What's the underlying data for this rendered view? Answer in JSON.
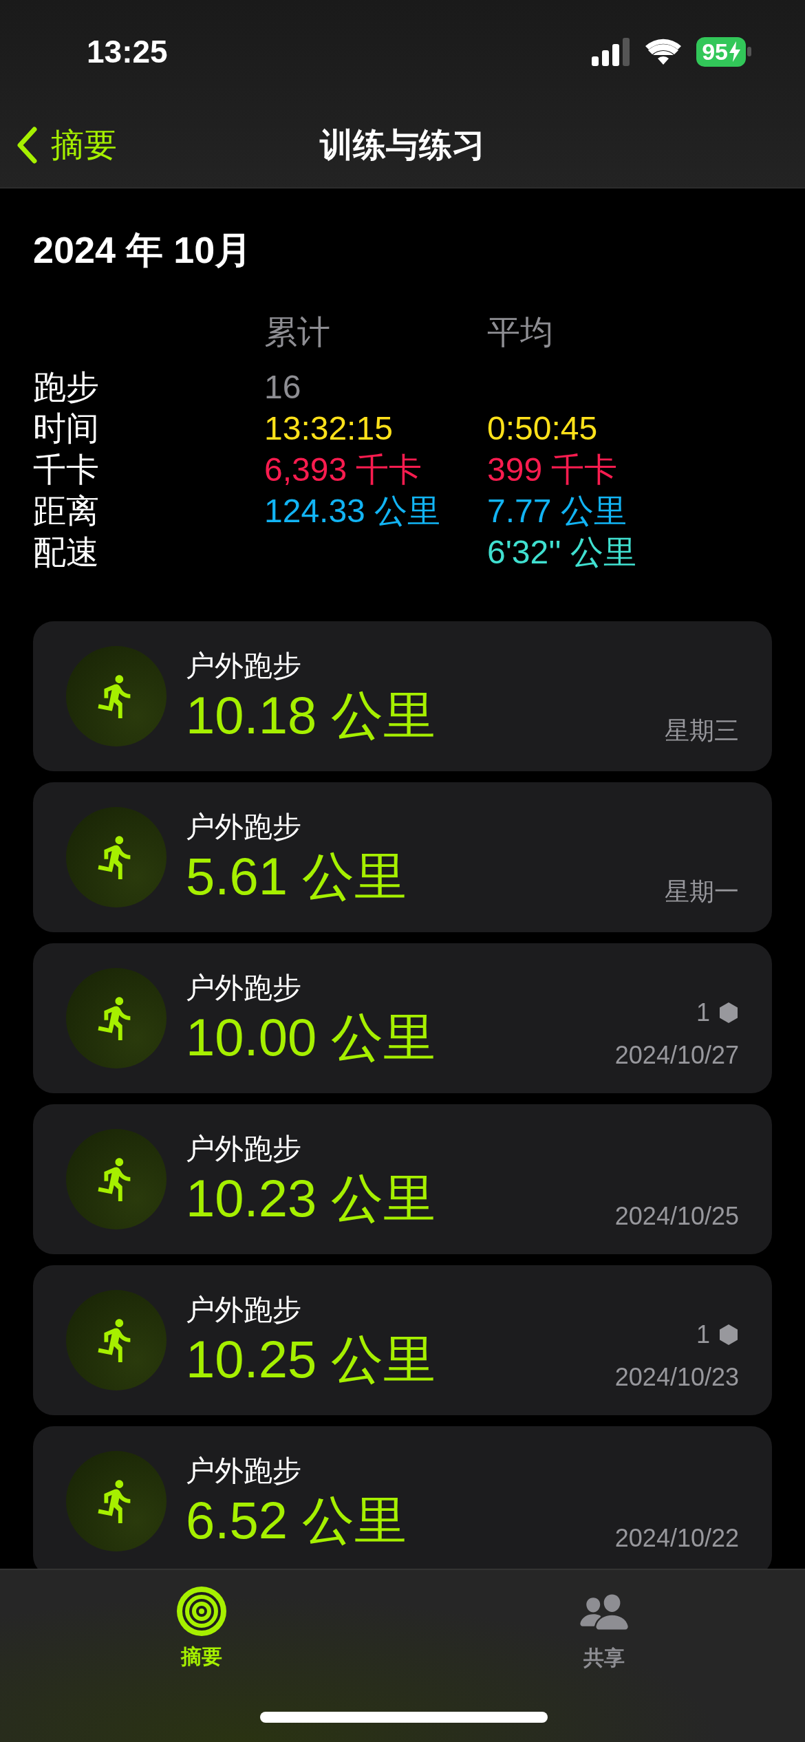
{
  "status_bar": {
    "time": "13:25",
    "battery": "95"
  },
  "nav": {
    "back": "摘要",
    "title": "训练与练习"
  },
  "month": "2024 年 10月",
  "stats": {
    "columns": [
      "累计",
      "平均"
    ],
    "rows": [
      {
        "label": "跑步",
        "total": "16",
        "color": "#8e8e93"
      },
      {
        "label": "时间",
        "total": "13:32:15",
        "average": "0:50:45",
        "color": "#ffe11a"
      },
      {
        "label": "千卡",
        "total": "6,393 千卡",
        "average": "399 千卡",
        "color": "#fa1c4f"
      },
      {
        "label": "距离",
        "total": "124.33 公里",
        "average": "7.77 公里",
        "color": "#12b4f4"
      },
      {
        "label": "配速",
        "average": "6'32'' 公里",
        "color": "#40e0d0"
      }
    ]
  },
  "workouts": [
    {
      "title": "户外跑步",
      "distance": "10.18 公里",
      "date": "星期三"
    },
    {
      "title": "户外跑步",
      "distance": "5.61 公里",
      "date": "星期一"
    },
    {
      "title": "户外跑步",
      "distance": "10.00 公里",
      "date": "2024/10/27",
      "badge": "1"
    },
    {
      "title": "户外跑步",
      "distance": "10.23 公里",
      "date": "2024/10/25"
    },
    {
      "title": "户外跑步",
      "distance": "10.25 公里",
      "date": "2024/10/23",
      "badge": "1"
    },
    {
      "title": "户外跑步",
      "distance": "6.52 公里",
      "date": "2024/10/22"
    }
  ],
  "tabs": [
    {
      "label": "摘要",
      "selected": true
    },
    {
      "label": "共享",
      "selected": false
    }
  ]
}
